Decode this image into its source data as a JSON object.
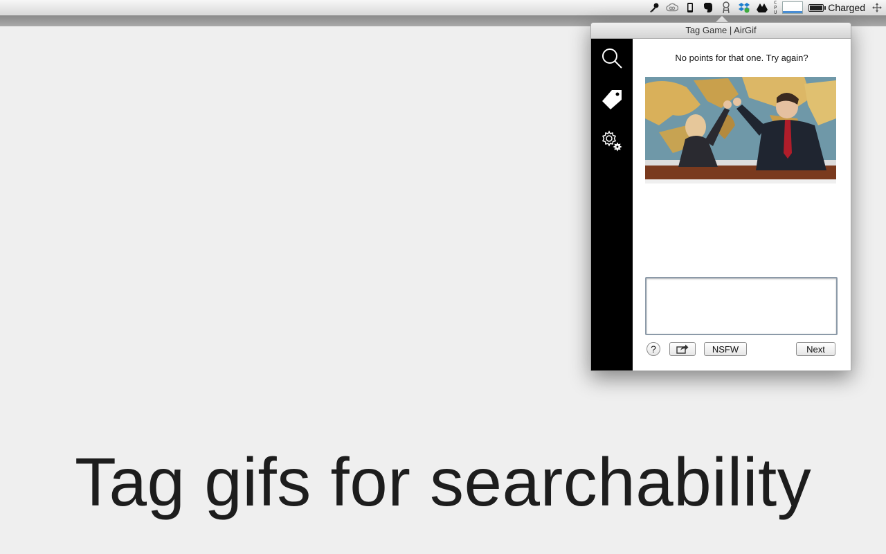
{
  "menubar": {
    "icons": [
      "key-icon",
      "creative-cloud-icon",
      "phone-icon",
      "evernote-icon",
      "airgif-icon",
      "dropbox-icon",
      "google-drive-icon",
      "cpu-monitor-icon",
      "memory-graph-icon",
      "battery-icon",
      "move-icon"
    ],
    "cpu_letters": [
      "C",
      "P",
      "U"
    ],
    "battery_status": "Charged"
  },
  "popover": {
    "title": "Tag Game | AirGif",
    "sidebar": {
      "items": [
        {
          "icon": "search-icon"
        },
        {
          "icon": "tag-icon"
        },
        {
          "icon": "settings-gear-icon"
        }
      ]
    },
    "message": "No points for that one. Try again?",
    "gif": {
      "description_icon": "gif-preview"
    },
    "tag_input": {
      "value": "",
      "placeholder": ""
    },
    "buttons": {
      "help": "?",
      "share_icon": "share-icon",
      "nsfw": "NSFW",
      "next": "Next"
    }
  },
  "caption": "Tag gifs for searchability",
  "colors": {
    "background": "#efefef",
    "sidebar": "#000000",
    "caption": "#1d1d1d"
  }
}
